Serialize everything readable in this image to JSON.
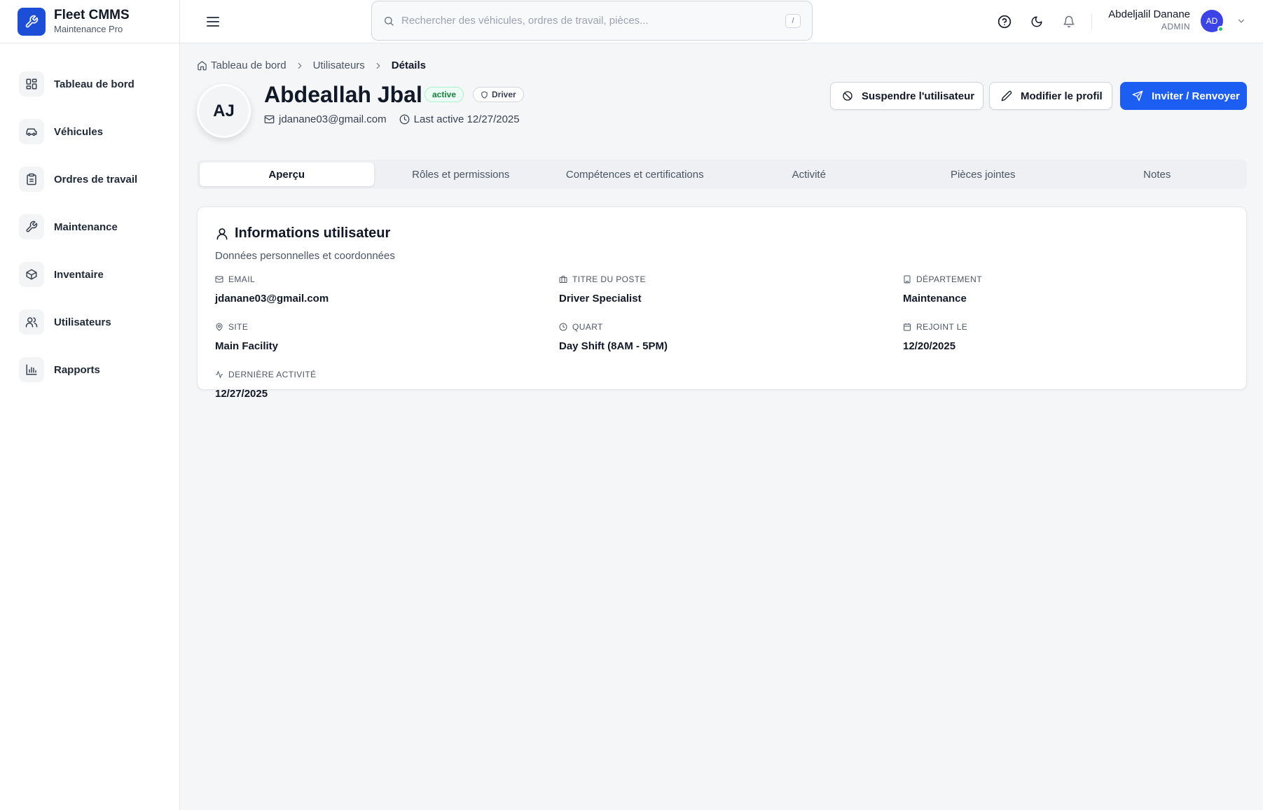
{
  "brand": {
    "name": "Fleet CMMS",
    "subtitle": "Maintenance Pro",
    "accent": "#1d4ed8"
  },
  "sidebar": {
    "items": [
      {
        "label": "Tableau de bord",
        "icon": "dashboard-icon"
      },
      {
        "label": "Véhicules",
        "icon": "car-icon"
      },
      {
        "label": "Ordres de travail",
        "icon": "clipboard-icon"
      },
      {
        "label": "Maintenance",
        "icon": "wrench-icon"
      },
      {
        "label": "Inventaire",
        "icon": "package-icon"
      },
      {
        "label": "Utilisateurs",
        "icon": "users-icon"
      },
      {
        "label": "Rapports",
        "icon": "bar-chart-icon"
      }
    ]
  },
  "header": {
    "search": {
      "placeholder": "Rechercher des véhicules, ordres de travail, pièces...",
      "value": "",
      "shortcut": "/"
    },
    "user": {
      "name": "Abdeljalil Danane",
      "role": "ADMIN",
      "initials": "AD"
    }
  },
  "breadcrumb": {
    "home": "Tableau de bord",
    "section": "Utilisateurs",
    "current": "Détails"
  },
  "profile": {
    "initials": "AJ",
    "name": "Abdeallah Jbal",
    "status": "active",
    "role": "Driver",
    "email": "jdanane03@gmail.com",
    "last_active": "Last active 12/27/2025"
  },
  "actions": {
    "suspend": "Suspendre l'utilisateur",
    "edit": "Modifier le profil",
    "invite": "Inviter / Renvoyer"
  },
  "tabs": [
    {
      "label": "Aperçu",
      "active": true
    },
    {
      "label": "Rôles et permissions",
      "active": false
    },
    {
      "label": "Compétences et certifications",
      "active": false
    },
    {
      "label": "Activité",
      "active": false
    },
    {
      "label": "Pièces jointes",
      "active": false
    },
    {
      "label": "Notes",
      "active": false
    }
  ],
  "info_card": {
    "title": "Informations utilisateur",
    "subtitle": "Données personnelles et coordonnées",
    "fields": {
      "email": {
        "label": "EMAIL",
        "value": "jdanane03@gmail.com"
      },
      "job_title": {
        "label": "TITRE DU POSTE",
        "value": "Driver Specialist"
      },
      "department": {
        "label": "DÉPARTEMENT",
        "value": "Maintenance"
      },
      "site": {
        "label": "SITE",
        "value": "Main Facility"
      },
      "shift": {
        "label": "QUART",
        "value": "Day Shift (8AM - 5PM)"
      },
      "joined": {
        "label": "REJOINT LE",
        "value": "12/20/2025"
      },
      "last_activity": {
        "label": "DERNIÈRE ACTIVITÉ",
        "value": "12/27/2025"
      }
    }
  }
}
